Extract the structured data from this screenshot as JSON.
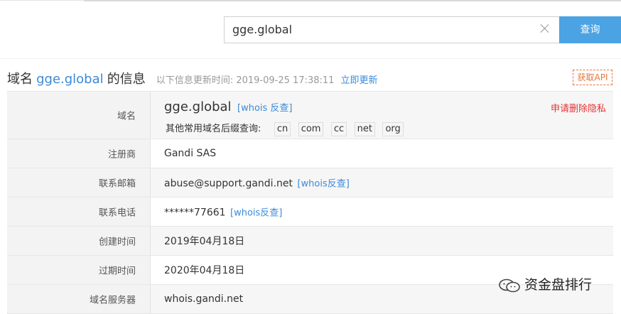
{
  "search": {
    "value": "gge.global",
    "button_label": "查询"
  },
  "header": {
    "title_prefix": "域名",
    "domain": "gge.global",
    "title_suffix": "的信息",
    "updated_label": "以下信息更新时间: 2019-09-25 17:38:11",
    "update_now": "立即更新",
    "api_button": "获取API"
  },
  "rows": {
    "domain": {
      "label": "域名",
      "value": "gge.global",
      "whois_link": "[whois 反查]",
      "remove_privacy": "申请删除隐私",
      "suffix_label": "其他常用域名后缀查询:",
      "suffixes": [
        "cn",
        "com",
        "cc",
        "net",
        "org"
      ]
    },
    "registrar": {
      "label": "注册商",
      "value": "Gandi SAS"
    },
    "email": {
      "label": "联系邮箱",
      "value": "abuse@support.gandi.net",
      "link": "[whois反查]"
    },
    "phone": {
      "label": "联系电话",
      "value": "******77661",
      "link": "[whois反查]"
    },
    "created": {
      "label": "创建时间",
      "value": "2019年04月18日"
    },
    "expires": {
      "label": "过期时间",
      "value": "2020年04月18日"
    },
    "nameserver": {
      "label": "域名服务器",
      "value": "whois.gandi.net"
    }
  },
  "watermark": {
    "text": "资金盘排行",
    "icon": "wechat-icon"
  }
}
